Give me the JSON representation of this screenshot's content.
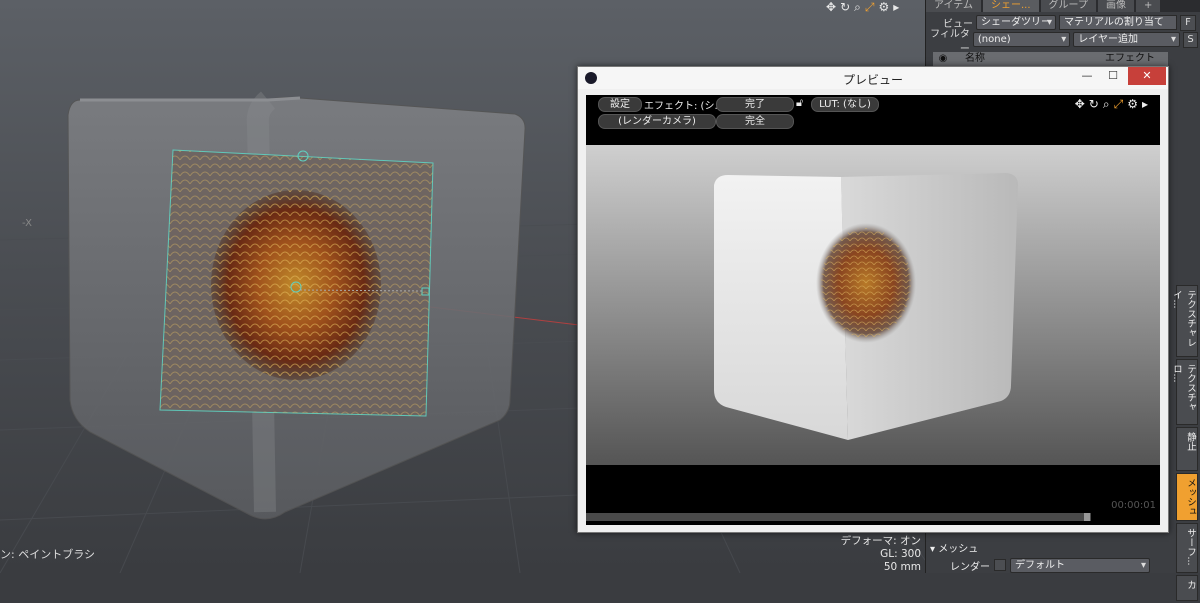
{
  "viewport": {
    "axis_label": "-X",
    "status_left": "ン: ペイントブラシ",
    "status_right": [
      "デフォーマ: オン",
      "GL: 300",
      "50 mm"
    ],
    "toolbar_icons": [
      "move-icon",
      "rotate-icon",
      "zoom-icon",
      "fit-icon",
      "gear-icon",
      "arrow-right-icon"
    ]
  },
  "panel": {
    "tabs": [
      "アイテム",
      "シェー...",
      "グループ",
      "画像",
      "+"
    ],
    "view_label": "ビュー",
    "view_value": "シェーダツリー",
    "assign_button": "マテリアルの割り当て",
    "f_button": "F",
    "filter_label": "フィルター",
    "filter_value": "(none)",
    "add_layer": "レイヤー追加",
    "s_button": "S",
    "list_columns": [
      "名称",
      "エフェクト"
    ],
    "vtabs": [
      "テクスチャレイ...",
      "テクスチャロ...",
      "静止",
      "メッシュ",
      "サーフ...",
      "カ"
    ],
    "mesh_section": "メッシュ",
    "render_label": "レンダー",
    "render_value": "デフォルト"
  },
  "preview": {
    "title": "プレビュー",
    "settings_button": "設定",
    "effect_label": "エフェクト: (シ...",
    "done_button": "完了",
    "lut_button": "LUT: (なし)",
    "camera_button": "(レンダーカメラ)",
    "complete_button": "完全",
    "timecode": "00:00:01"
  },
  "colors": {
    "accent": "#f0a030",
    "selection": "#5fd0c0",
    "close": "#c7403a"
  }
}
